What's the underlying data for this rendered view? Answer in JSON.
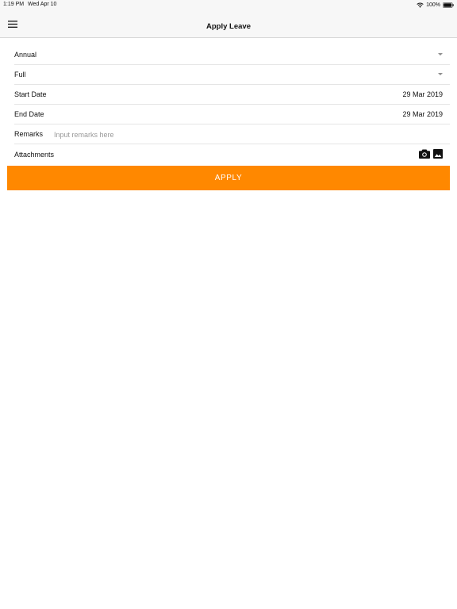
{
  "status_bar": {
    "time": "1:19 PM",
    "date": "Wed Apr 10",
    "battery": "100%",
    "icons": [
      "wifi-icon",
      "battery-icon"
    ]
  },
  "nav": {
    "title": "Apply Leave",
    "menu_icon": "hamburger-menu-icon"
  },
  "form": {
    "leave_type": "Annual",
    "day_type": "Full",
    "start_date": {
      "label": "Start Date",
      "value": "29 Mar 2019"
    },
    "end_date": {
      "label": "End Date",
      "value": "29 Mar 2019"
    },
    "remarks": {
      "label": "Remarks",
      "value": "",
      "placeholder": "Input remarks here"
    },
    "attachments": {
      "label": "Attachments",
      "icons": [
        "camera-icon",
        "image-icon"
      ]
    }
  },
  "actions": {
    "apply_label": "APPLY",
    "accent_color": "#ff8800"
  }
}
